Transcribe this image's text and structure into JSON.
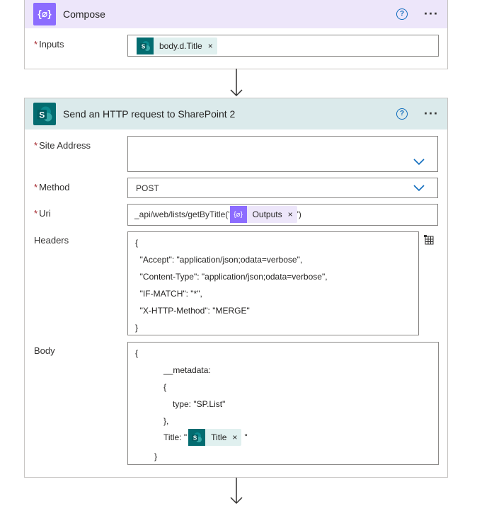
{
  "compose": {
    "icon_text": "{⌀}",
    "title": "Compose",
    "help": "?",
    "more": "···",
    "inputs_label": "Inputs",
    "required_mark": "*",
    "inputs_token": "body.d.Title",
    "token_close": "×"
  },
  "sharepoint": {
    "title": "Send an HTTP request to SharePoint 2",
    "help": "?",
    "more": "···",
    "site_address_label": "Site Address",
    "site_address_value": "",
    "method_label": "Method",
    "method_value": "POST",
    "uri_label": "Uri",
    "uri_prefix": "_api/web/lists/getByTitle('",
    "uri_token": "Outputs",
    "uri_suffix": "')",
    "headers_label": "Headers",
    "headers_lines": [
      "{",
      "  \"Accept\": \"application/json;odata=verbose\",",
      "  \"Content-Type\": \"application/json;odata=verbose\",",
      "  \"IF-MATCH\": \"*\",",
      "  \"X-HTTP-Method\": \"MERGE\"",
      "}"
    ],
    "body_label": "Body",
    "body_lines": [
      "{",
      "__metadata:",
      "{",
      "type: \"SP.List\"",
      "},"
    ],
    "body_title_prefix": "Title: \"",
    "body_title_token": "Title",
    "body_title_suffix": "\"",
    "body_close": "}"
  },
  "colors": {
    "compose_header": "#ede6fa",
    "compose_icon": "#8c6cff",
    "sp_header": "#dbeaeb",
    "sp_icon": "#036c70",
    "required": "#a4262c",
    "link_blue": "#0f6cbd"
  }
}
